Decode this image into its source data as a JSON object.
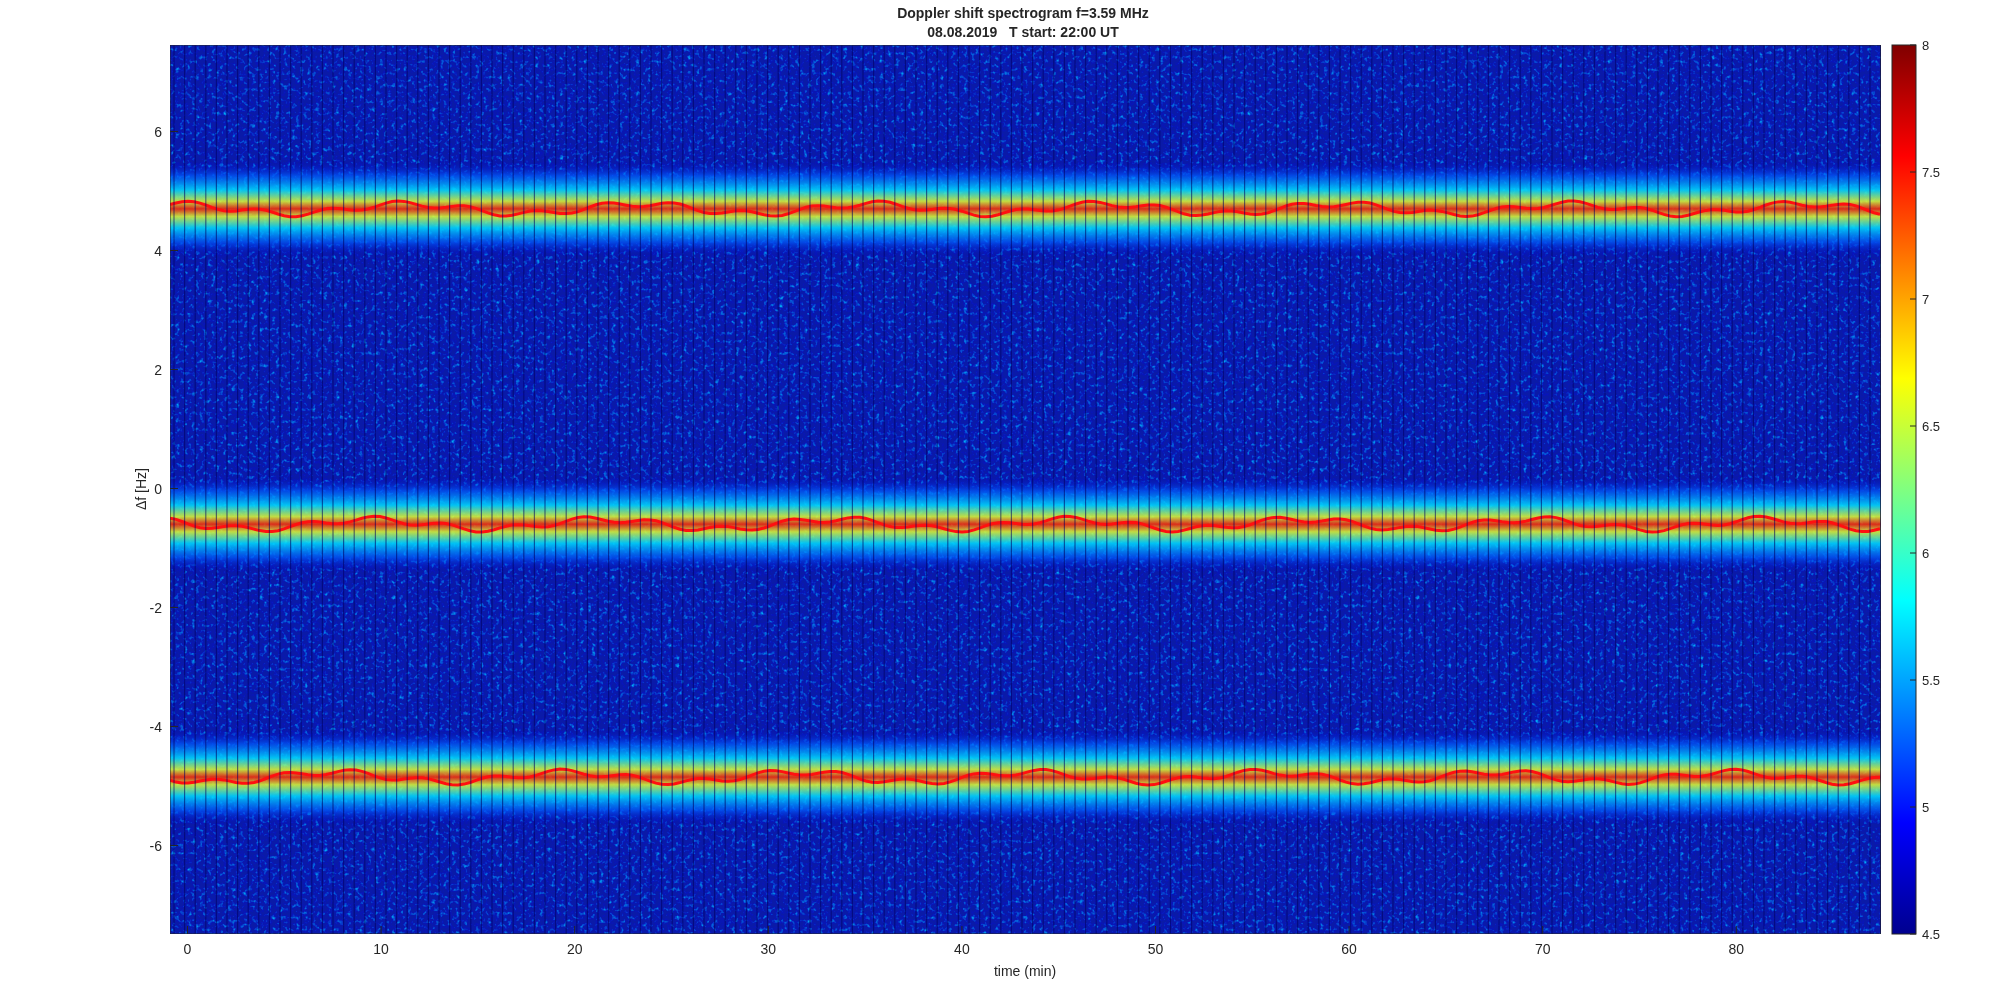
{
  "title": {
    "line_1": "Doppler shift spectrogram f=3.59 MHz",
    "line_2": "08.08.2019   T start: 22:00 UT"
  },
  "axes": {
    "xlabel": "time (min)",
    "ylabel": "Δf [Hz]",
    "xticks": [
      "0",
      "10",
      "20",
      "30",
      "40",
      "50",
      "60",
      "70",
      "80"
    ],
    "yticks": [
      "6",
      "4",
      "2",
      "0",
      "-2",
      "-4",
      "-6"
    ]
  },
  "colorbar": {
    "ticks": [
      "8",
      "7.5",
      "7",
      "6.5",
      "6",
      "5.5",
      "5",
      "4.5"
    ]
  }
}
